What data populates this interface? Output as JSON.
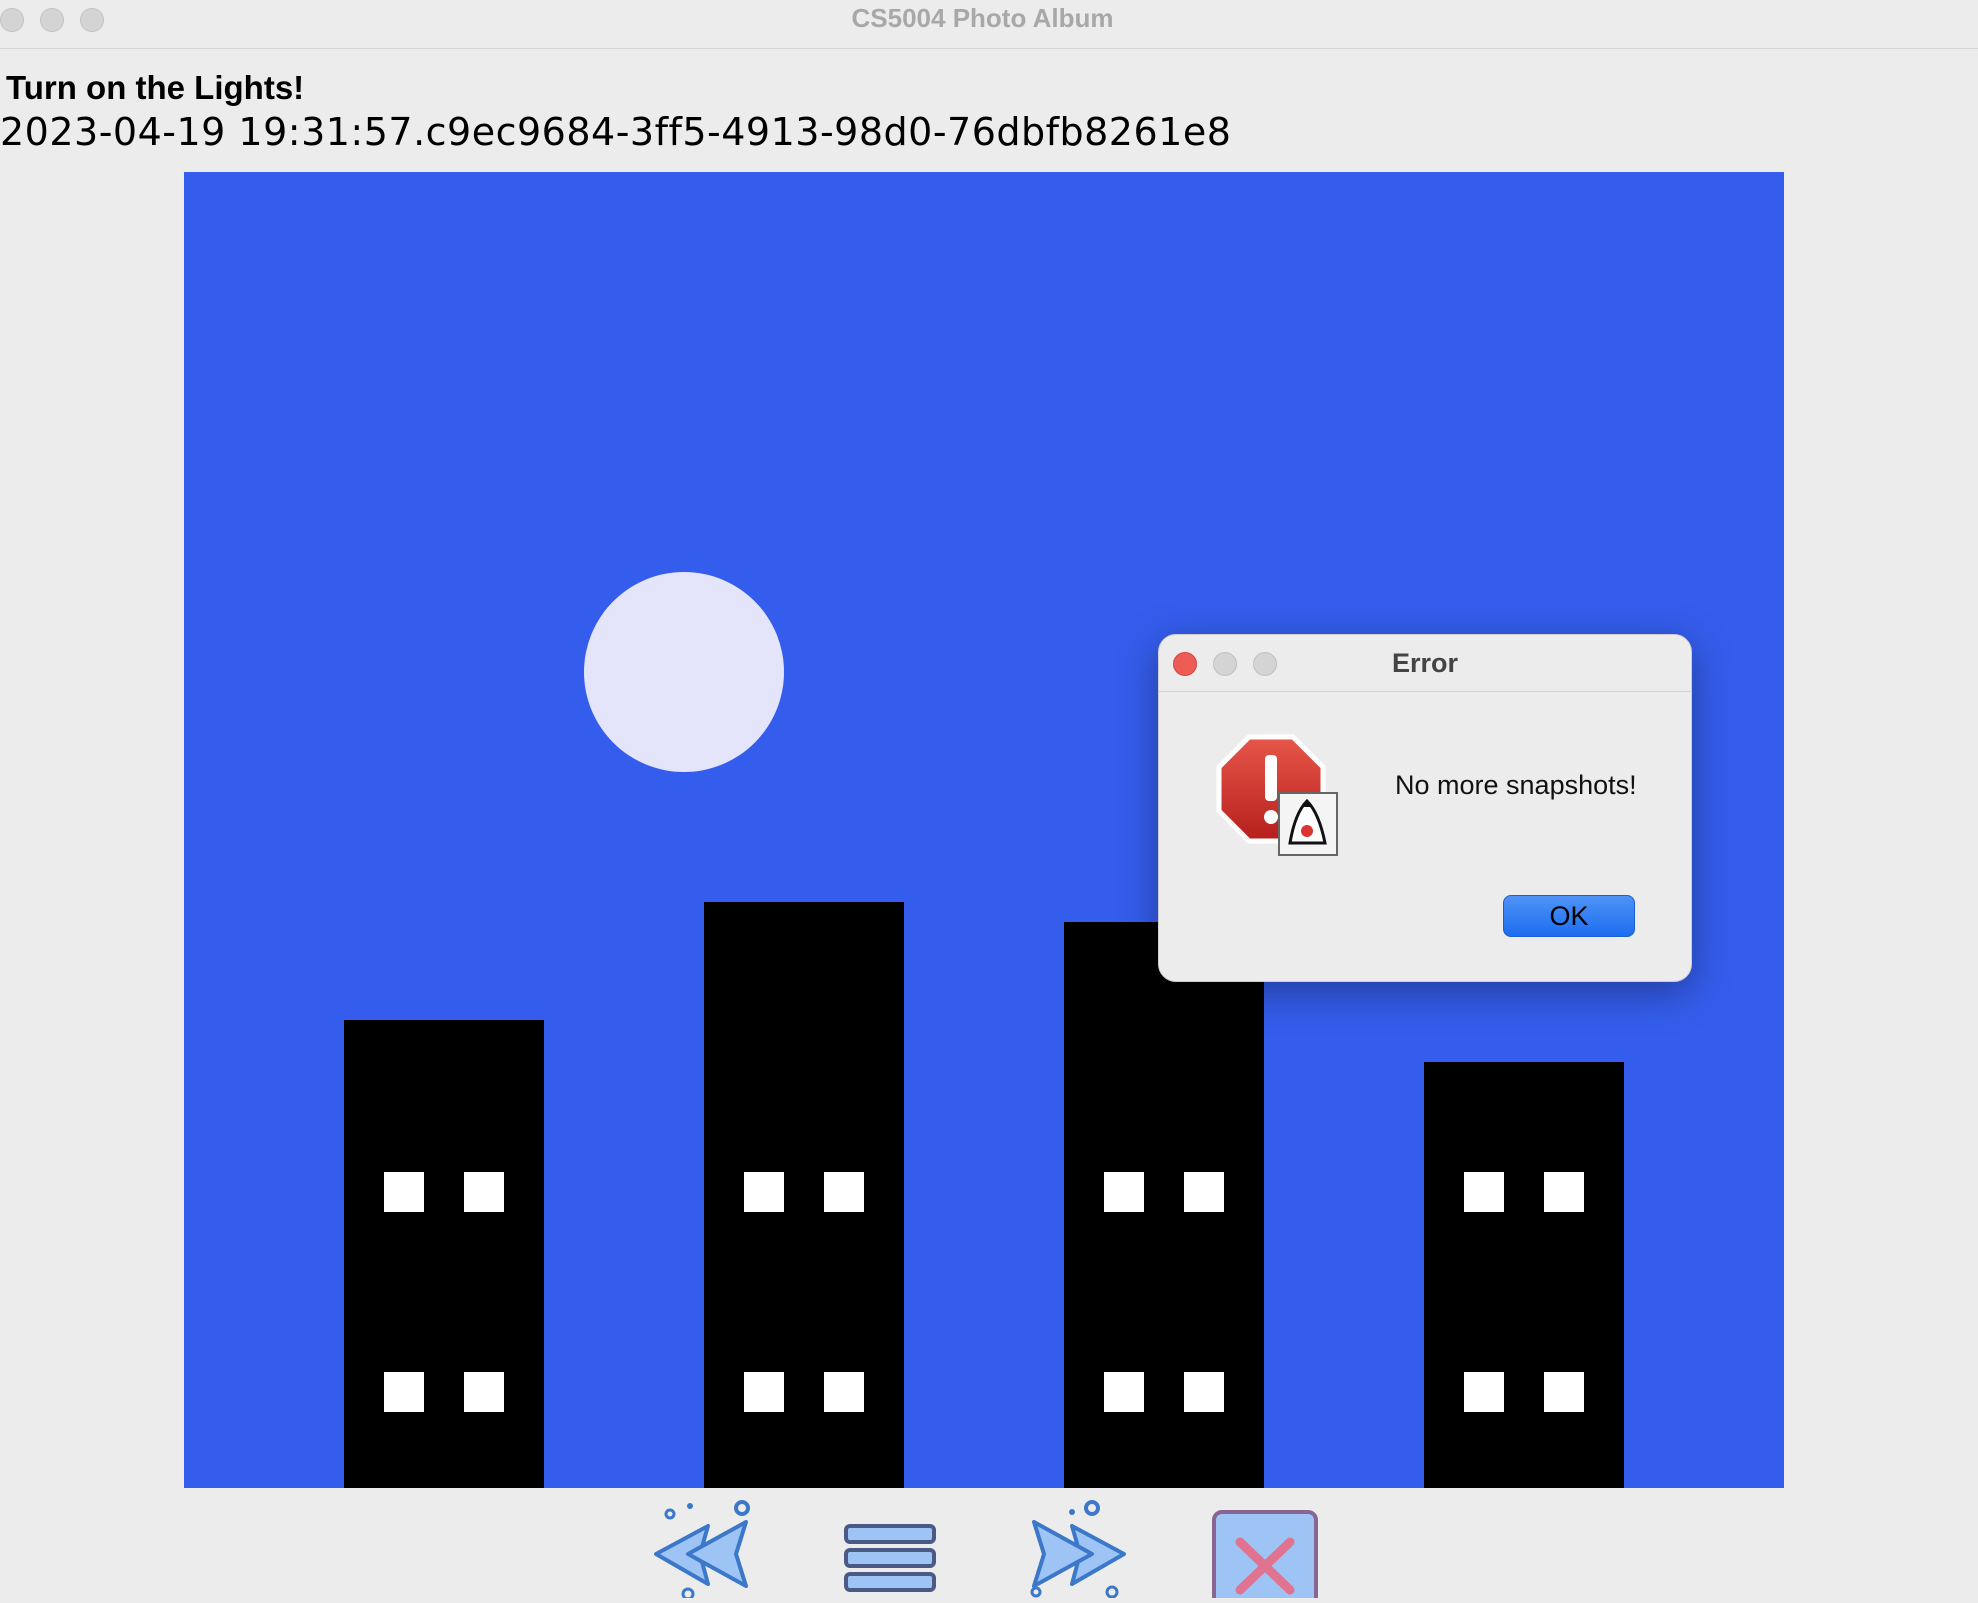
{
  "window": {
    "title": "CS5004 Photo Album"
  },
  "snapshot": {
    "description": "Turn on the Lights!",
    "id": "2023-04-19 19:31:57.c9ec9684-3ff5-4913-98d0-76dbfb8261e8"
  },
  "colors": {
    "sky": "#345ded",
    "moon": "#e4e4fa",
    "building": "#000000",
    "window_light": "#ffffff"
  },
  "toolbar": {
    "buttons": [
      {
        "name": "previous-icon"
      },
      {
        "name": "list-icon"
      },
      {
        "name": "next-icon"
      },
      {
        "name": "close-icon"
      }
    ]
  },
  "dialog": {
    "title": "Error",
    "message": "No more snapshots!",
    "ok_label": "OK",
    "icon": "error-stop-icon"
  }
}
